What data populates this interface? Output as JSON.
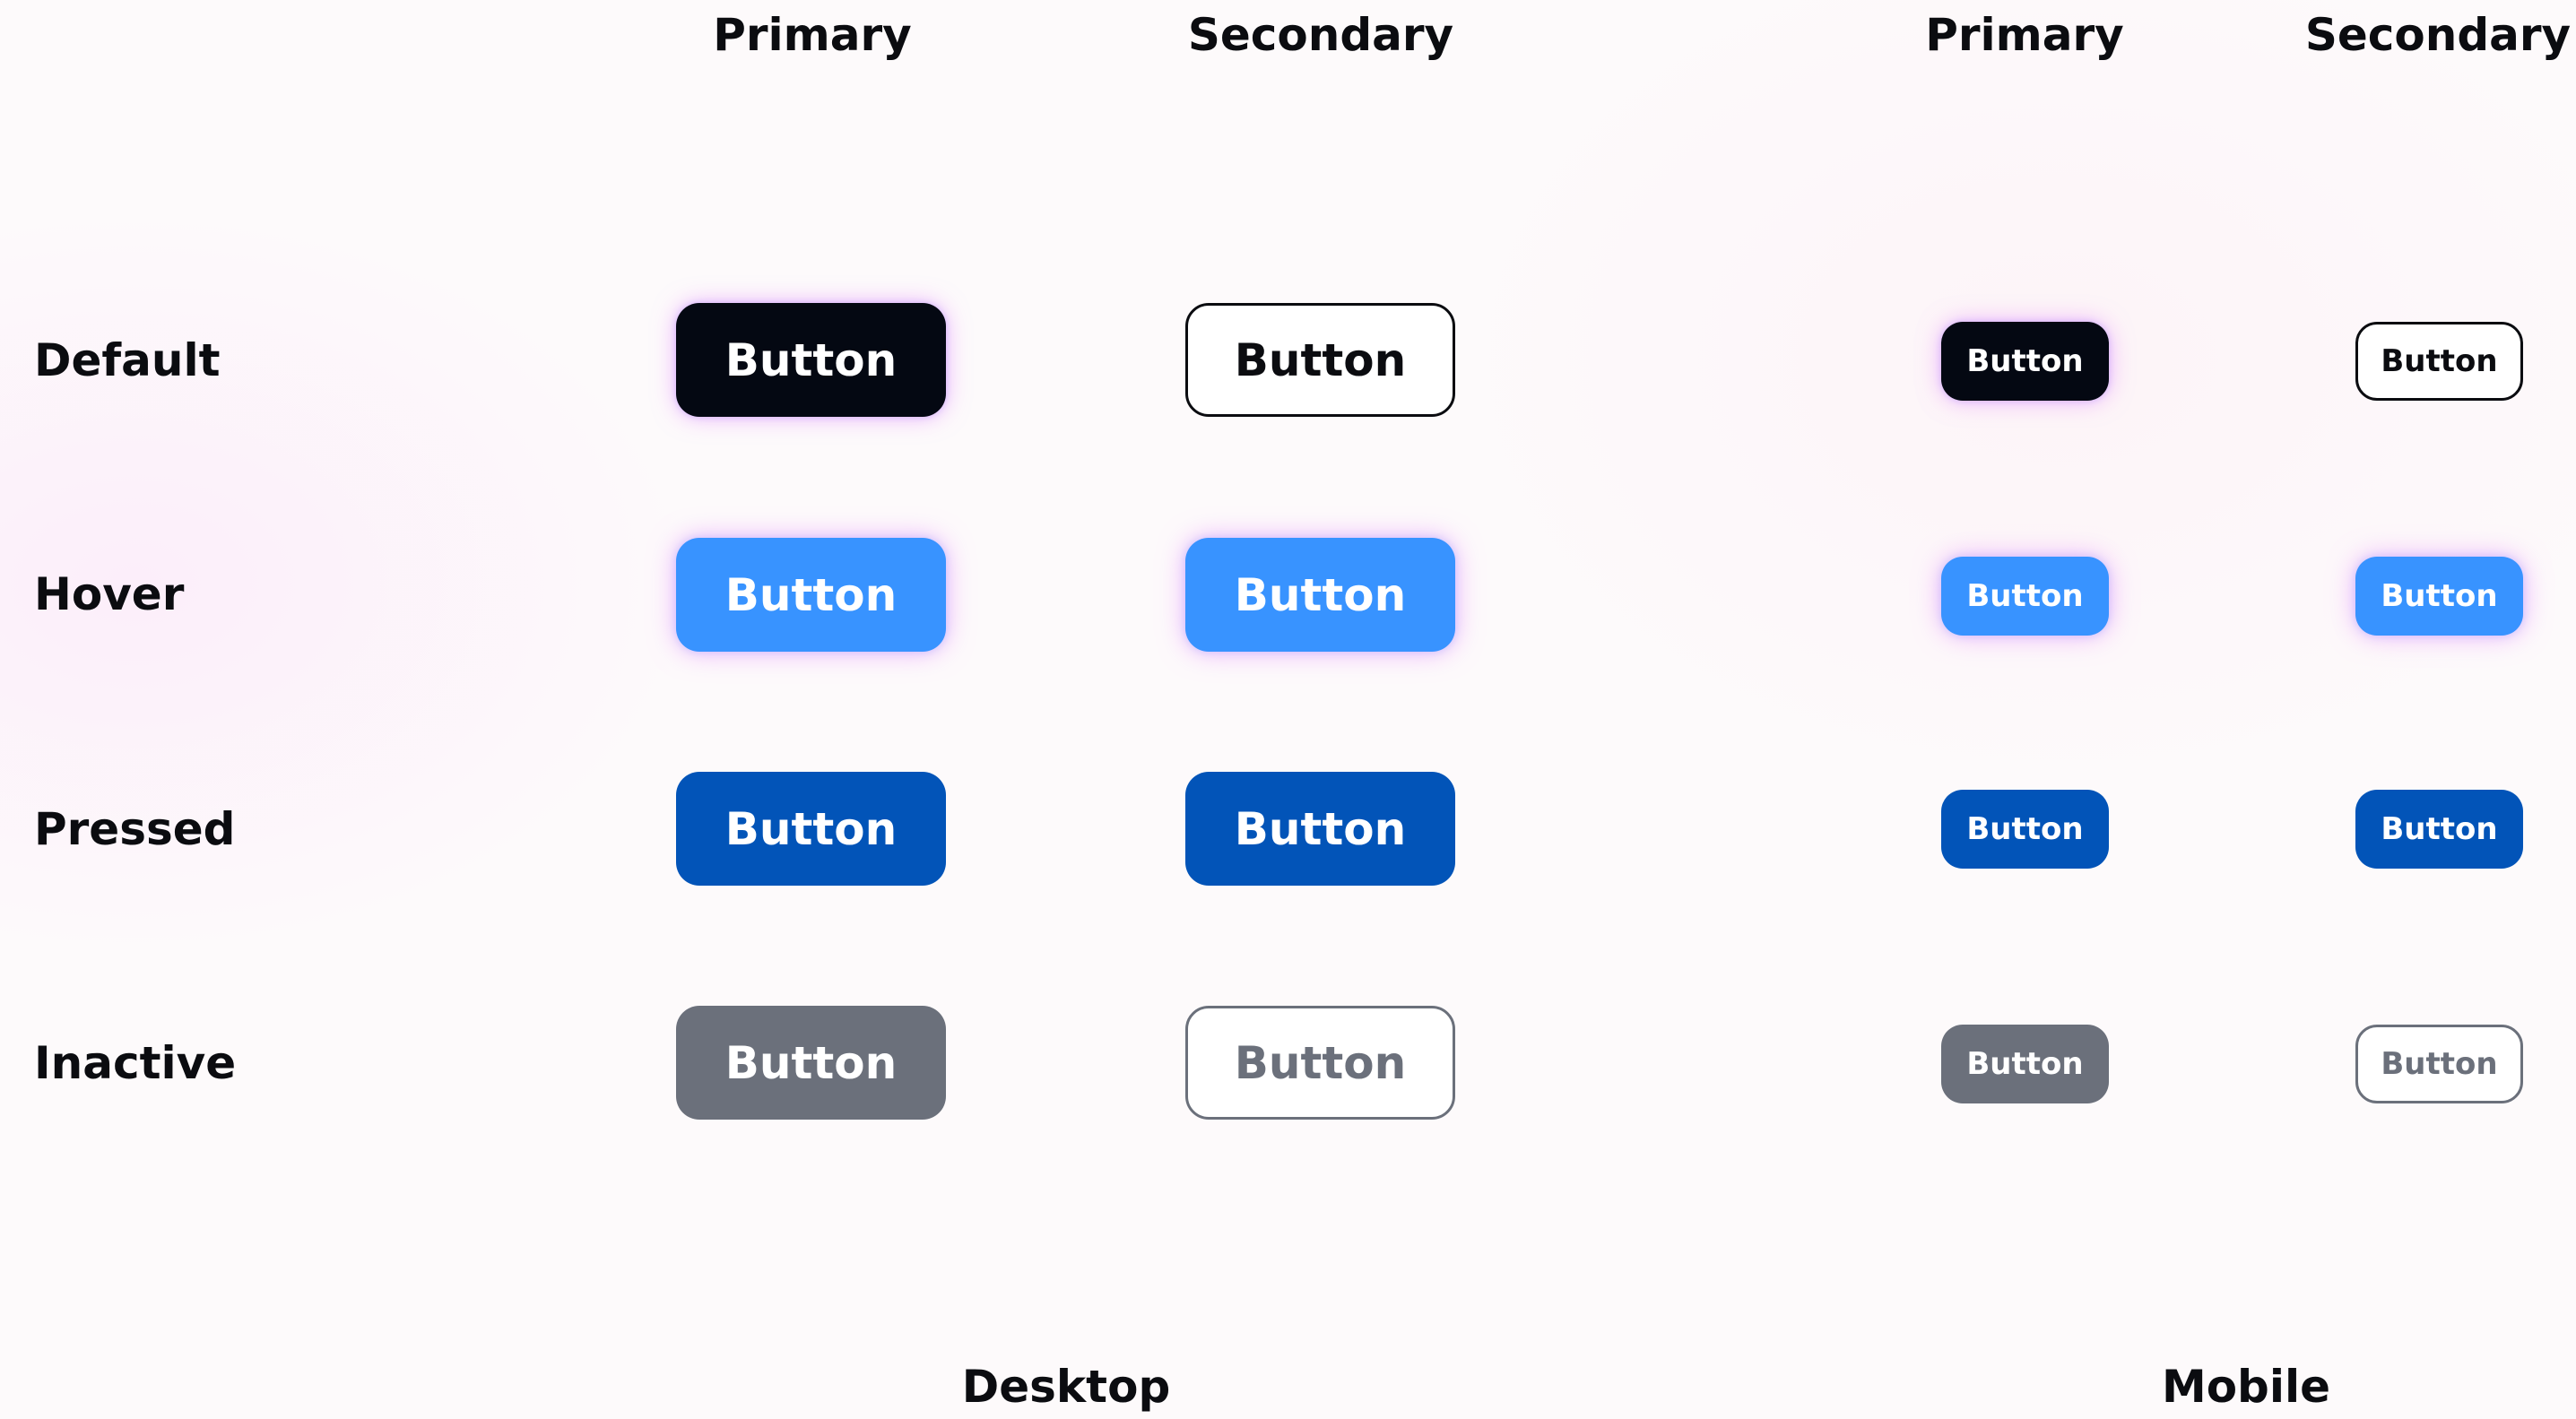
{
  "colors": {
    "primary_default_bg": "#040812",
    "hover_bg": "#3893ff",
    "pressed_bg": "#0254b8",
    "inactive": "#6b707b",
    "text_dark": "#0b0c10",
    "glow": "#e078ff"
  },
  "headers": {
    "desktop_primary": "Primary",
    "desktop_secondary": "Secondary",
    "mobile_primary": "Primary",
    "mobile_secondary": "Secondary"
  },
  "rows": {
    "default": "Default",
    "hover": "Hover",
    "pressed": "Pressed",
    "inactive": "Inactive"
  },
  "sections": {
    "desktop": "Desktop",
    "mobile": "Mobile"
  },
  "buttons": {
    "label": "Button"
  }
}
